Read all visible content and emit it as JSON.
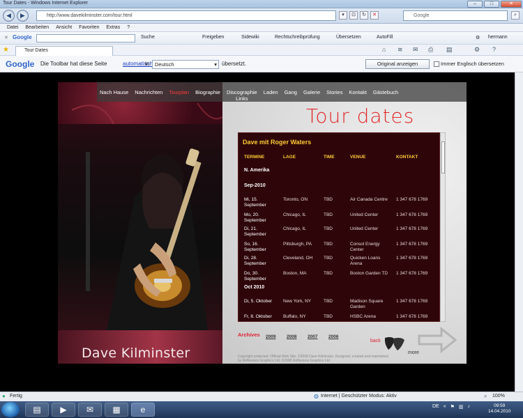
{
  "window": {
    "title": "Tour Dates - Windows Internet Explorer",
    "controls": [
      "–",
      "□",
      "✕"
    ]
  },
  "addressbar": {
    "url": "http://www.davekilminster.com/tour.html",
    "search_placeholder": "Google"
  },
  "menu": [
    "Datei",
    "Bearbeiten",
    "Ansicht",
    "Favoriten",
    "Extras",
    "?"
  ],
  "google_toolbar": {
    "label": "Google",
    "items": [
      "Suche",
      "Freigeben",
      "Sidewiki",
      "Rechtschreibprüfung",
      "Übersetzen",
      "AutoFill"
    ],
    "user": "hermann"
  },
  "tab": {
    "label": "Tour Dates"
  },
  "translate_bar": {
    "logo": "Google",
    "text_before": "Die Toolbar hat diese Seite",
    "link": "automatisch",
    "text_mid": "in",
    "language": "Deutsch",
    "text_after": "übersetzt.",
    "show_original": "Original anzeigen",
    "always_english": "Immer Englisch übersetzen"
  },
  "site": {
    "nav": [
      "Nach Hause",
      "Nachrichten",
      "Tourplan",
      "Biographie",
      "Discographie",
      "Laden",
      "Gang",
      "Galerie",
      "Stories",
      "Kontakt",
      "Gästebuch"
    ],
    "nav_sub": "Links",
    "active_nav": "Tourplan",
    "heading": "Tour dates",
    "brand": "Dave Kilminster",
    "panel": {
      "title": "Dave mit Roger Waters",
      "headers": [
        "TERMINE",
        "LAGE",
        "TIME",
        "VENUE",
        "KONTAKT"
      ],
      "region": "N. Amerika",
      "months": [
        "Sep-2010",
        "Oct 2010"
      ],
      "rows": [
        {
          "date": "Mi, 15. September",
          "lage": "Toronto, ON",
          "time": "TBD",
          "venue": "Air Canada Centre",
          "kontakt": "1 347 678 1769"
        },
        {
          "date": "Mo, 20. September",
          "lage": "Chicago, IL",
          "time": "TBD",
          "venue": "United Center",
          "kontakt": "1 347 678 1769"
        },
        {
          "date": "Di, 21. September",
          "lage": "Chicago, IL",
          "time": "TBD",
          "venue": "United Center",
          "kontakt": "1 347 678 1769"
        },
        {
          "date": "So, 16. September",
          "lage": "Pittsburgh, PA",
          "time": "TBD",
          "venue": "Consol Energy Center",
          "kontakt": "1 347 678 1769"
        },
        {
          "date": "Di, 28. September",
          "lage": "Cleveland, OH",
          "time": "TBD",
          "venue": "Quicken Loans Arena",
          "kontakt": "1 347 678 1769"
        },
        {
          "date": "Do, 30. September",
          "lage": "Boston, MA",
          "time": "TBD",
          "venue": "Boston Garden TD",
          "kontakt": "1 347 678 1769"
        },
        {
          "date": "Di, 5. Oktober",
          "lage": "New York, NY",
          "time": "TBD",
          "venue": "Madison Square Garden",
          "kontakt": "1 347 678 1769"
        },
        {
          "date": "Fr, 8. Oktober",
          "lage": "Buffalo, NY",
          "time": "TBD",
          "venue": "HSBC Arena",
          "kontakt": "1 347 678 1769"
        }
      ]
    },
    "archives": {
      "label": "Archives",
      "years": [
        "2009",
        "2008",
        "2007",
        "2006"
      ]
    },
    "back": "back",
    "more": "more",
    "footer": "Copyright protected. Official Web Site, ©2008 Dave Kilminster. Designed, created and maintained by Reflexions Graphics Ltd, ©2008 Reflexions Graphics Ltd."
  },
  "statusbar": {
    "left": "Fertig",
    "mid": "Internet | Geschützter Modus: Aktiv",
    "zoom": "100%"
  },
  "taskbar": {
    "lang": "DE",
    "time": "09:59",
    "date": "14.04.2010"
  }
}
